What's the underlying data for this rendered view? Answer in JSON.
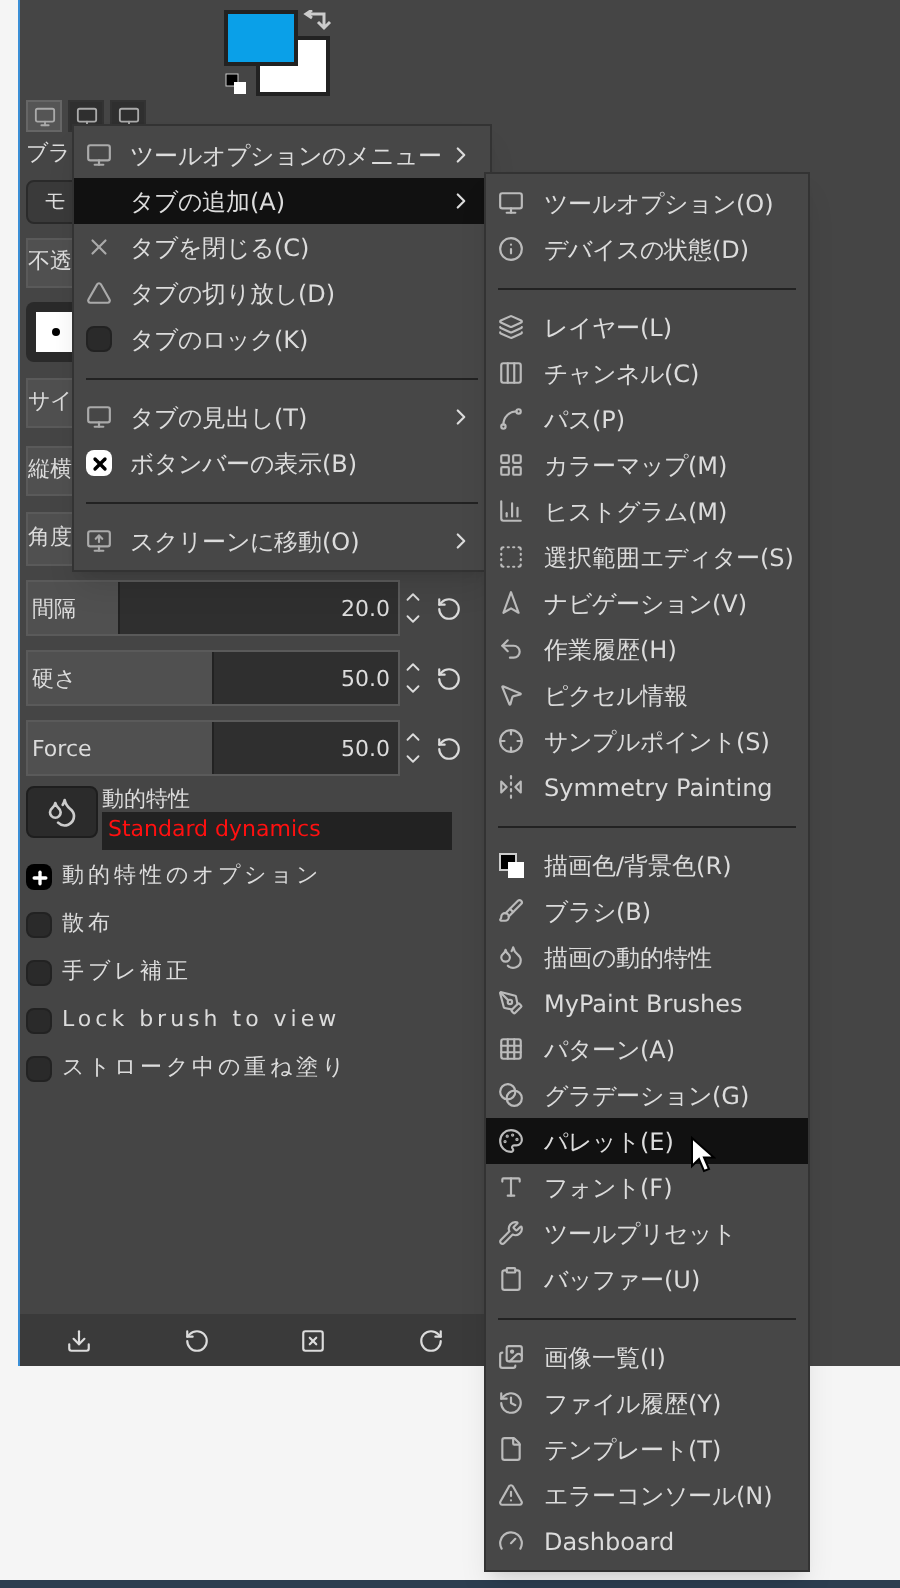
{
  "dock": {
    "tabs": [
      {
        "selected": true
      },
      {
        "selected": false
      },
      {
        "selected": false
      }
    ],
    "tool_options": {
      "title": "ブラ",
      "mode": "モ",
      "opacity": "不透",
      "size": "サイ",
      "aspect": "縦横",
      "angle": "角度"
    },
    "sliders": [
      {
        "label": "間隔",
        "value": "20.0",
        "level": 0.25
      },
      {
        "label": "硬さ",
        "value": "50.0",
        "level": 0.5
      },
      {
        "label": "Force",
        "value": "50.0",
        "level": 0.5
      }
    ],
    "dynamics": {
      "label": "動的特性",
      "value": "Standard dynamics"
    },
    "options": [
      {
        "label": "動的特性のオプション",
        "kind": "expander",
        "expanded": false
      },
      {
        "label": "散布",
        "kind": "checkbox",
        "checked": false
      },
      {
        "label": "手ブレ補正",
        "kind": "checkbox",
        "checked": false
      },
      {
        "label": "Lock brush to view",
        "kind": "checkbox",
        "checked": false
      },
      {
        "label": "ストローク中の重ね塗り",
        "kind": "checkbox",
        "checked": false
      }
    ]
  },
  "context_menu": [
    [
      {
        "label": "ツールオプションのメニュー",
        "kind": "icon",
        "submenu": true,
        "selected": false
      },
      {
        "label": "タブの追加(A)",
        "kind": "icon",
        "submenu": true,
        "selected": true
      },
      {
        "label": "タブを閉じる(C)",
        "kind": "icon",
        "submenu": false,
        "selected": false
      },
      {
        "label": "タブの切り放し(D)",
        "kind": "icon",
        "submenu": false,
        "selected": false
      },
      {
        "label": "タブのロック(K)",
        "kind": "check",
        "checked": false,
        "submenu": false,
        "selected": false
      }
    ],
    [
      {
        "label": "タブの見出し(T)",
        "kind": "icon",
        "submenu": true,
        "selected": false
      },
      {
        "label": "ボタンバーの表示(B)",
        "kind": "check",
        "checked": true,
        "submenu": false,
        "selected": false
      }
    ],
    [
      {
        "label": "スクリーンに移動(O)",
        "kind": "icon",
        "submenu": true,
        "selected": false
      }
    ]
  ],
  "add_tab_menu": [
    [
      {
        "label": "ツールオプション(O)",
        "selected": false
      },
      {
        "label": "デバイスの状態(D)",
        "selected": false
      }
    ],
    [
      {
        "label": "レイヤー(L)",
        "selected": false
      },
      {
        "label": "チャンネル(C)",
        "selected": false
      },
      {
        "label": "パス(P)",
        "selected": false
      },
      {
        "label": "カラーマップ(M)",
        "selected": false
      },
      {
        "label": "ヒストグラム(M)",
        "selected": false
      },
      {
        "label": "選択範囲エディター(S)",
        "selected": false
      },
      {
        "label": "ナビゲーション(V)",
        "selected": false
      },
      {
        "label": "作業履歴(H)",
        "selected": false
      },
      {
        "label": "ピクセル情報",
        "selected": false
      },
      {
        "label": "サンプルポイント(S)",
        "selected": false
      },
      {
        "label": "Symmetry Painting",
        "selected": false
      }
    ],
    [
      {
        "label": "描画色/背景色(R)",
        "selected": false
      },
      {
        "label": "ブラシ(B)",
        "selected": false
      },
      {
        "label": "描画の動的特性",
        "selected": false
      },
      {
        "label": "MyPaint Brushes",
        "selected": false
      },
      {
        "label": "パターン(A)",
        "selected": false
      },
      {
        "label": "グラデーション(G)",
        "selected": false
      },
      {
        "label": "パレット(E)",
        "selected": true
      },
      {
        "label": "フォント(F)",
        "selected": false
      },
      {
        "label": "ツールプリセット",
        "selected": false
      },
      {
        "label": "バッファー(U)",
        "selected": false
      }
    ],
    [
      {
        "label": "画像一覧(I)",
        "selected": false
      },
      {
        "label": "ファイル履歴(Y)",
        "selected": false
      },
      {
        "label": "テンプレート(T)",
        "selected": false
      },
      {
        "label": "エラーコンソール(N)",
        "selected": false
      },
      {
        "label": "Dashboard",
        "selected": false
      }
    ]
  ]
}
